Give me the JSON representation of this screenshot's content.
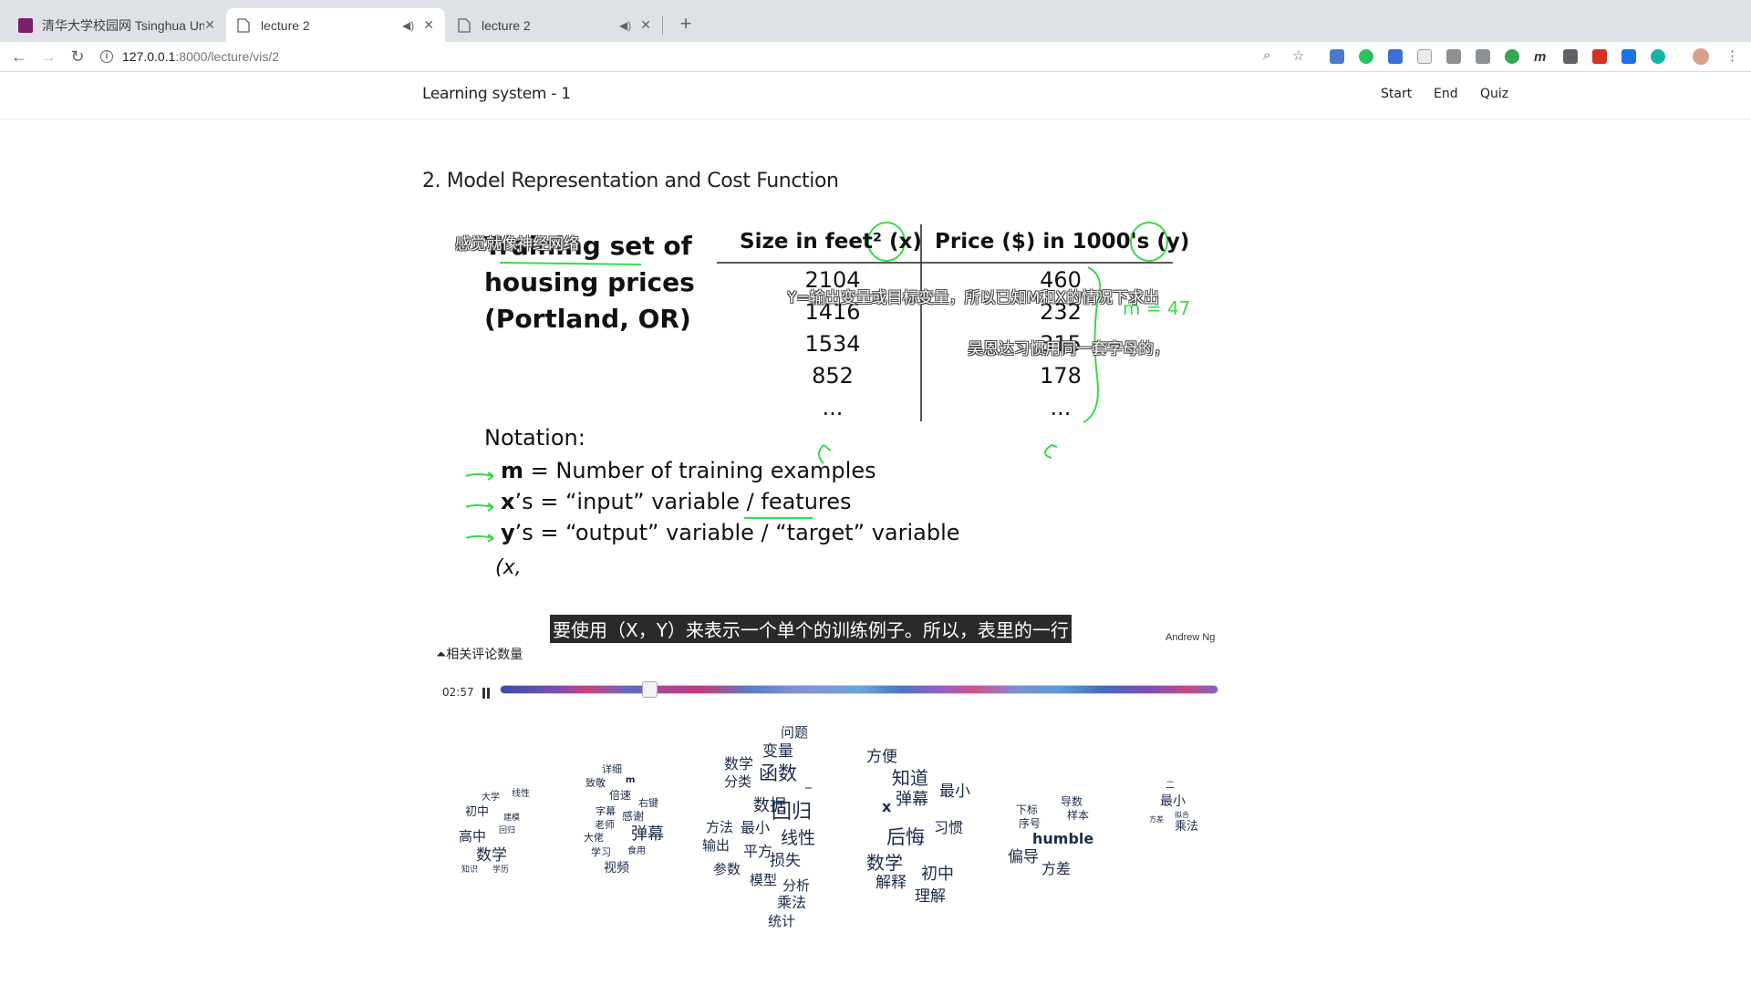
{
  "browser": {
    "tabs": [
      {
        "title": "清华大学校园网 Tsinghua Unive",
        "active": false
      },
      {
        "title": "lecture 2",
        "active": true
      },
      {
        "title": "lecture 2",
        "active": false
      }
    ],
    "url_host": "127.0.0.1",
    "url_path": ":8000/lecture/vis/2"
  },
  "app": {
    "brand": "Learning system - 1",
    "nav": [
      "Start",
      "End",
      "Quiz"
    ]
  },
  "lecture": {
    "title": "2. Model Representation and Cost Function"
  },
  "slide": {
    "heading_lines": [
      "Training set of",
      "housing prices",
      "(Portland, OR)"
    ],
    "col1_header": "Size in feet² (x)",
    "col2_header": "Price ($) in 1000's (y)",
    "col1_values": [
      "2104",
      "1416",
      "1534",
      "852",
      "..."
    ],
    "col2_values": [
      "460",
      "232",
      "315",
      "178",
      "..."
    ],
    "handwritten_m": "m = 47",
    "notation_label": "Notation:",
    "notation_items": [
      {
        "bold": "m",
        "text": " = Number of training examples"
      },
      {
        "bold": "x",
        "text": "’s = “input” variable / features"
      },
      {
        "bold": "y",
        "text": "’s = “output” variable / “target” variable"
      }
    ],
    "handwritten_xy": "(x,",
    "author": "Andrew Ng"
  },
  "danmaku": [
    "感觉就像神经网络",
    "Y=输出变量或目标变量，所以已知M和X的情况下求出",
    "吴恩达习惯用同一套字母的，",
    "要使用（X，Y）来表示一个单个的训练例子。所以，表里的一行"
  ],
  "player": {
    "related_label": "相关评论数量",
    "current_time": "02:57",
    "progress": 0.21
  },
  "wordclouds": [
    [
      "大学",
      "线性",
      "初中",
      "建模",
      "回归",
      "高中",
      "数学",
      "知识",
      "学历"
    ],
    [
      "详细",
      "m",
      "致敬",
      "倍速",
      "右键",
      "字幕",
      "感谢",
      "老师",
      "大佬",
      "弹幕",
      "学习",
      "食用",
      "视频"
    ],
    [
      "问题",
      "变量",
      "数学",
      "函数",
      "_",
      "分类",
      "数据",
      "回归",
      "方法",
      "最小",
      "线性",
      "输出",
      "平方",
      "损失",
      "参数",
      "模型",
      "分析",
      "乘法",
      "统计"
    ],
    [
      "方便",
      "知道",
      "最小",
      "x",
      "弹幕",
      "习惯",
      "后悔",
      "数学",
      "初中",
      "解释",
      "理解"
    ],
    [
      "导数",
      "下标",
      "样本",
      "序号",
      "humble",
      "偏导",
      "方差"
    ],
    [
      "二",
      "最小",
      "方差",
      "拟合",
      "乘法"
    ]
  ]
}
